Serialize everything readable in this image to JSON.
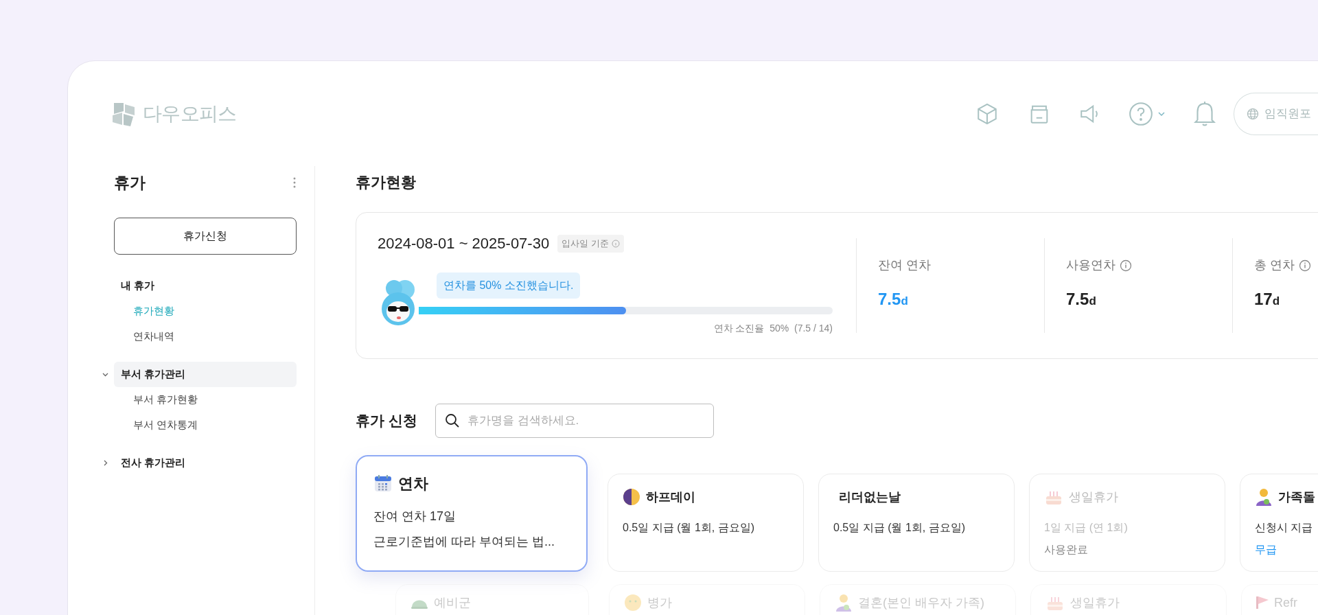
{
  "header": {
    "logo_text": "다우오피스",
    "portal_button": "임직원포"
  },
  "sidebar": {
    "title": "휴가",
    "apply_button": "휴가신청",
    "groups": [
      {
        "label": "내 휴가",
        "kind": "static",
        "selected": false,
        "children": [
          {
            "label": "휴가현황",
            "selected": true
          },
          {
            "label": "연차내역",
            "selected": false
          }
        ]
      },
      {
        "label": "부서 휴가관리",
        "kind": "collapsible",
        "expanded": true,
        "selected": true,
        "children": [
          {
            "label": "부서 휴가현황",
            "selected": false
          },
          {
            "label": "부서 연차통계",
            "selected": false
          }
        ]
      },
      {
        "label": "전사 휴가관리",
        "kind": "collapsible",
        "expanded": false,
        "selected": false
      }
    ]
  },
  "status": {
    "title": "휴가현황",
    "period": "2024-08-01 ~ 2025-07-30",
    "basis": "입사일 기준",
    "bubble": "연차를 50% 소진했습니다.",
    "level": 0.5,
    "usage": "연차 소진율  50%  (7.5 / 14)",
    "stats": [
      {
        "label": "잔여 연차",
        "value": "7.5",
        "unit": "d",
        "info": false,
        "highlight": true
      },
      {
        "label": "사용연차",
        "value": "7.5",
        "unit": "d",
        "info": true,
        "highlight": false
      },
      {
        "label": "총 연차",
        "value": "17",
        "unit": "d",
        "info": true,
        "highlight": false
      }
    ]
  },
  "apply": {
    "title": "휴가 신청",
    "search": {
      "placeholder": "휴가명을 검색하세요."
    },
    "cards": [
      {
        "title": "연차",
        "kind": "calendar",
        "selected": true,
        "disabled": false,
        "lines": [
          {
            "text": "잔여 연차 17일",
            "kind": "normal"
          },
          {
            "text": "근로기준법에 따라 부여되는 법...",
            "kind": "normal"
          }
        ]
      },
      {
        "title": "하프데이",
        "kind": "moon",
        "selected": false,
        "disabled": false,
        "lines": [
          {
            "text": "0.5일 지급 (월 1회, 금요일)",
            "kind": "normal"
          }
        ]
      },
      {
        "title": "리더없는날",
        "kind": "plain",
        "selected": false,
        "disabled": false,
        "lines": [
          {
            "text": "0.5일 지급 (월 1회, 금요일)",
            "kind": "normal"
          }
        ]
      },
      {
        "title": "생일휴가",
        "kind": "cake",
        "selected": false,
        "disabled": true,
        "lines": [
          {
            "text": "1일 지급 (연 1회)",
            "kind": "normal"
          },
          {
            "text": "사용완료",
            "kind": "status"
          }
        ]
      },
      {
        "title": "가족돌",
        "kind": "person",
        "selected": false,
        "disabled": false,
        "lines": [
          {
            "text": "신청시 지급",
            "kind": "normal"
          },
          {
            "text": "무급",
            "kind": "accent"
          }
        ]
      }
    ],
    "more_cards": [
      {
        "title": "예비군",
        "kind": "helmet"
      },
      {
        "title": "병가",
        "kind": "face"
      },
      {
        "title": "결혼(본인 배우자 가족)",
        "kind": "person"
      },
      {
        "title": "생일휴가",
        "kind": "cake"
      },
      {
        "title": "Refr",
        "kind": "flag"
      }
    ]
  }
}
